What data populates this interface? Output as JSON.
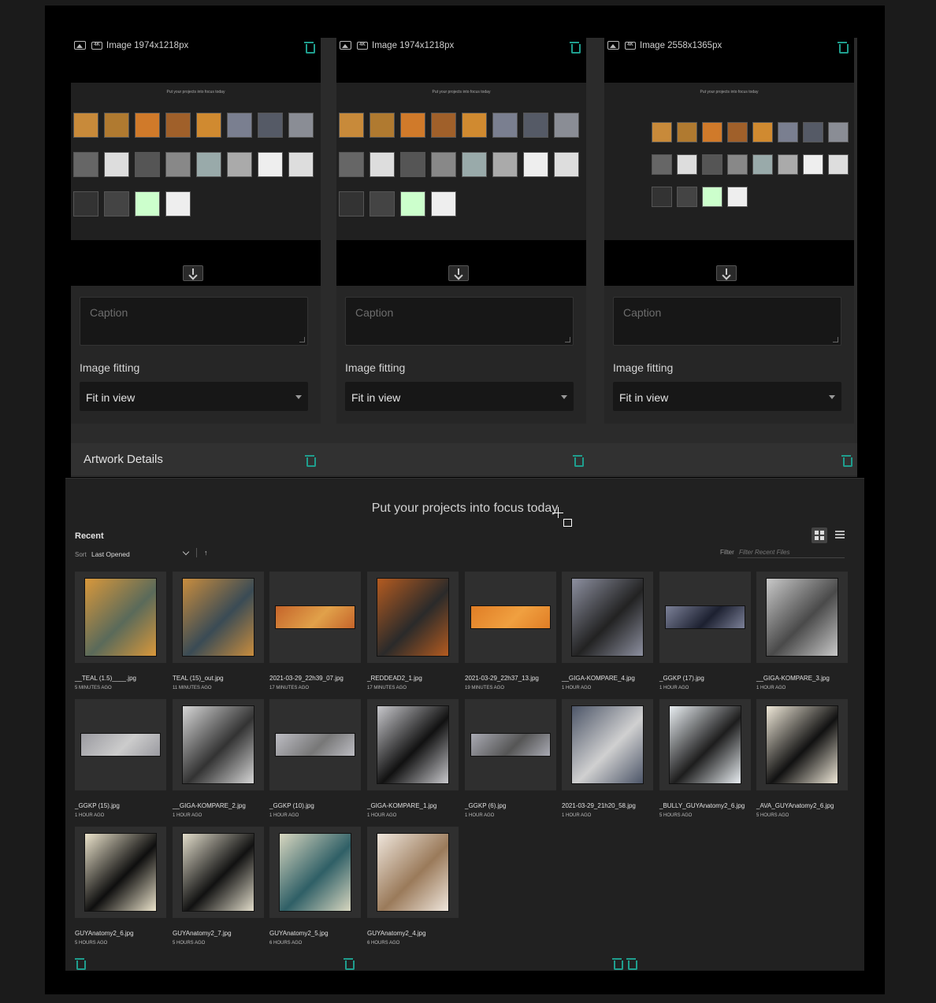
{
  "cards": [
    {
      "image_label": "Image 1974x1218px",
      "caption_placeholder": "Caption",
      "fitting_label": "Image fitting",
      "fitting_value": "Fit in view"
    },
    {
      "image_label": "Image 1974x1218px",
      "caption_placeholder": "Caption",
      "fitting_label": "Image fitting",
      "fitting_value": "Fit in view"
    },
    {
      "image_label": "Image 2558x1365px",
      "caption_placeholder": "Caption",
      "fitting_label": "Image fitting",
      "fitting_value": "Fit in view"
    }
  ],
  "details": {
    "title": "Artwork Details"
  },
  "app": {
    "title": "Put your projects into focus today",
    "recent_label": "Recent",
    "sort_label": "Sort",
    "sort_value": "Last Opened",
    "sort_arrow": "↑",
    "filter_label": "Filter",
    "filter_placeholder": "Filter Recent Files",
    "files": [
      {
        "name": "__TEAL (1.5)____.jpg",
        "time": "5 MINUTES AGO"
      },
      {
        "name": "TEAL (15)_out.jpg",
        "time": "11 MINUTES AGO"
      },
      {
        "name": "2021-03-29_22h39_07.jpg",
        "time": "17 MINUTES AGO"
      },
      {
        "name": "_REDDEAD2_1.jpg",
        "time": "17 MINUTES AGO"
      },
      {
        "name": "2021-03-29_22h37_13.jpg",
        "time": "19 MINUTES AGO"
      },
      {
        "name": "__GIGA-KOMPARE_4.jpg",
        "time": "1 HOUR AGO"
      },
      {
        "name": "_GGKP (17).jpg",
        "time": "1 HOUR AGO"
      },
      {
        "name": "__GIGA-KOMPARE_3.jpg",
        "time": "1 HOUR AGO"
      },
      {
        "name": "_GGKP (15).jpg",
        "time": "1 HOUR AGO"
      },
      {
        "name": "__GIGA-KOMPARE_2.jpg",
        "time": "1 HOUR AGO"
      },
      {
        "name": "_GGKP (10).jpg",
        "time": "1 HOUR AGO"
      },
      {
        "name": "_GIGA-KOMPARE_1.jpg",
        "time": "1 HOUR AGO"
      },
      {
        "name": "_GGKP (6).jpg",
        "time": "1 HOUR AGO"
      },
      {
        "name": "2021-03-29_21h20_58.jpg",
        "time": "1 HOUR AGO"
      },
      {
        "name": "_BULLY_GUYAnatomy2_6.jpg",
        "time": "5 HOURS AGO"
      },
      {
        "name": "_AVA_GUYAnatomy2_6.jpg",
        "time": "5 HOURS AGO"
      },
      {
        "name": "GUYAnatomy2_6.jpg",
        "time": "5 HOURS AGO"
      },
      {
        "name": "GUYAnatomy2_7.jpg",
        "time": "5 HOURS AGO"
      },
      {
        "name": "GUYAnatomy2_5.jpg",
        "time": "6 HOURS AGO"
      },
      {
        "name": "GUYAnatomy2_4.jpg",
        "time": "6 HOURS AGO"
      }
    ]
  },
  "colors": {
    "accent": "#1f9e8e",
    "panel": "#262626",
    "background": "#000000"
  },
  "icons": [
    "image-icon",
    "4k-icon",
    "trash-icon",
    "download-icon",
    "grid-view-icon",
    "list-view-icon",
    "chevron-down-icon",
    "sort-arrow-icon"
  ]
}
